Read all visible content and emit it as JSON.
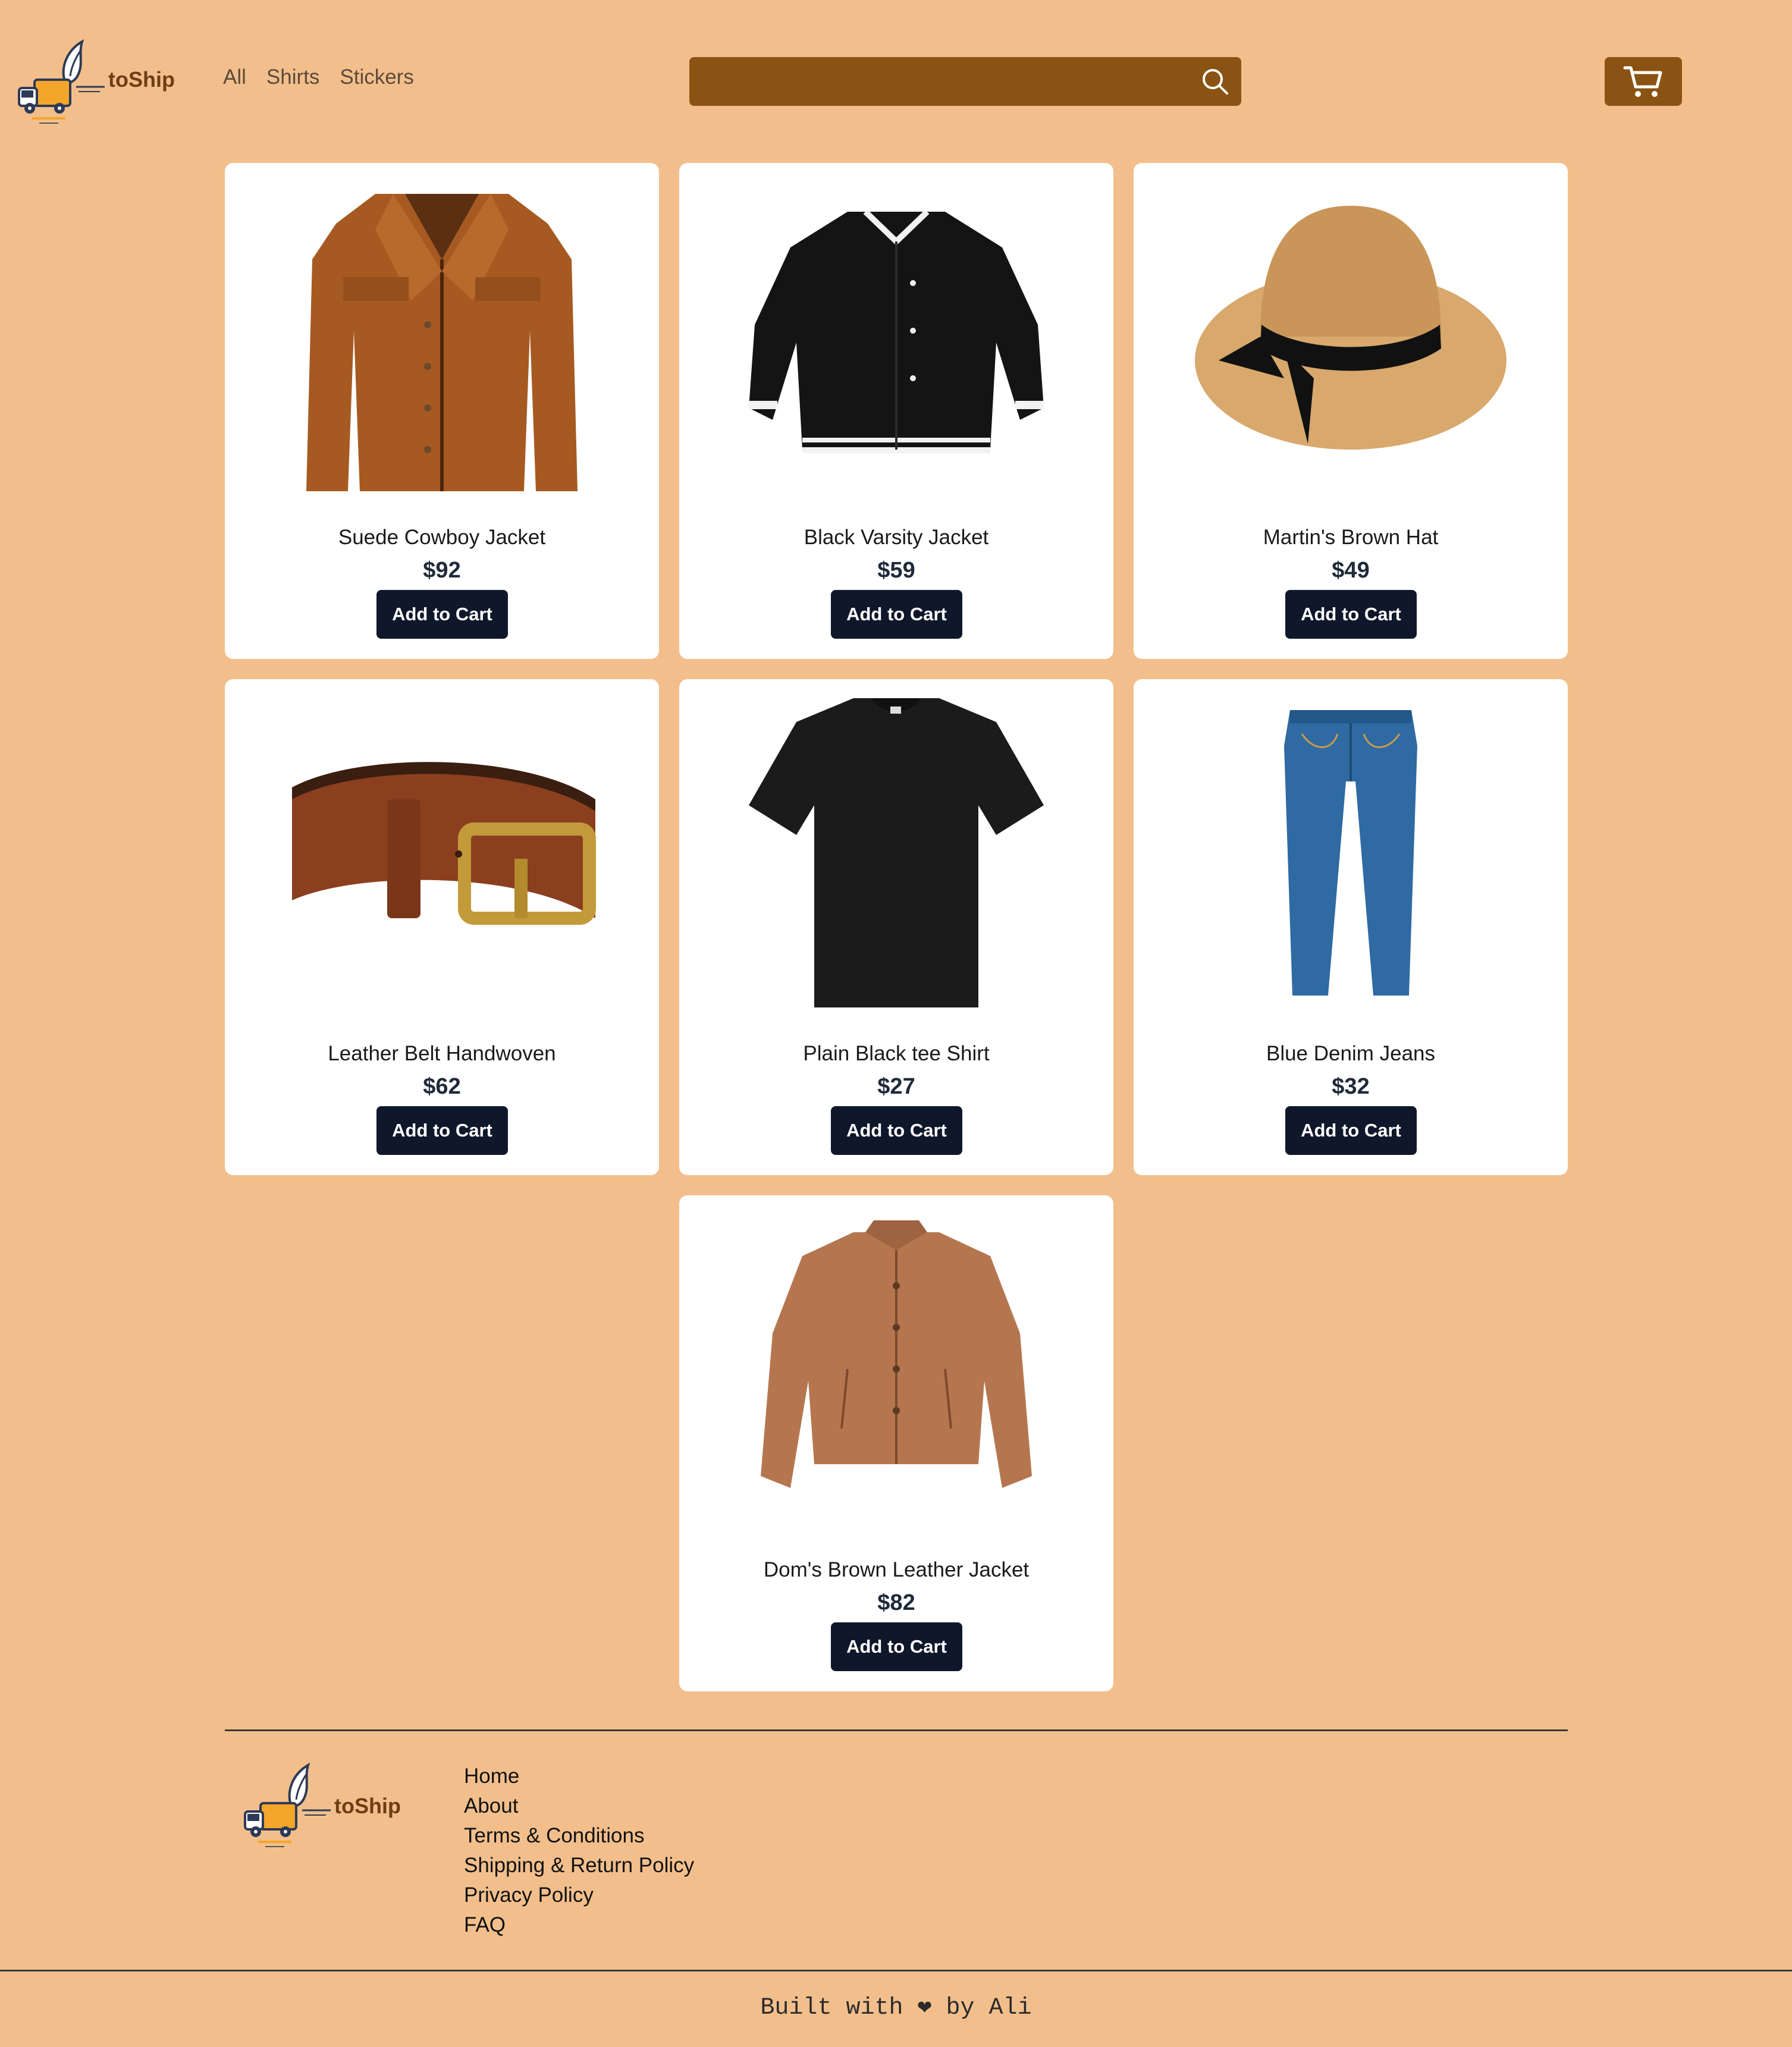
{
  "header": {
    "brand": "toShip",
    "nav": [
      "All",
      "Shirts",
      "Stickers"
    ],
    "search": {
      "placeholder": "",
      "value": ""
    },
    "icons": {
      "search": "search-icon",
      "cart": "cart-icon"
    }
  },
  "products": [
    {
      "name": "Suede Cowboy Jacket",
      "price": "$92",
      "button": "Add to Cart",
      "image": "suede-jacket-image"
    },
    {
      "name": "Black Varsity Jacket",
      "price": "$59",
      "button": "Add to Cart",
      "image": "varsity-jacket-image"
    },
    {
      "name": "Martin's Brown Hat",
      "price": "$49",
      "button": "Add to Cart",
      "image": "straw-hat-image"
    },
    {
      "name": "Leather Belt Handwoven",
      "price": "$62",
      "button": "Add to Cart",
      "image": "leather-belt-image"
    },
    {
      "name": "Plain Black tee Shirt",
      "price": "$27",
      "button": "Add to Cart",
      "image": "black-tee-image"
    },
    {
      "name": "Blue Denim Jeans",
      "price": "$32",
      "button": "Add to Cart",
      "image": "denim-jeans-image"
    },
    {
      "name": "Dom's Brown Leather Jacket",
      "price": "$82",
      "button": "Add to Cart",
      "image": "brown-leather-jacket-image"
    }
  ],
  "footer": {
    "brand": "toShip",
    "links": [
      "Home",
      "About",
      "Terms & Conditions",
      "Shipping & Return Policy",
      "Privacy Policy",
      "FAQ"
    ],
    "credit": "Built with ❤ by Ali"
  },
  "colors": {
    "background": "#f2bf8c",
    "header_control": "#8a5313",
    "button": "#0f172a",
    "card": "#ffffff"
  }
}
